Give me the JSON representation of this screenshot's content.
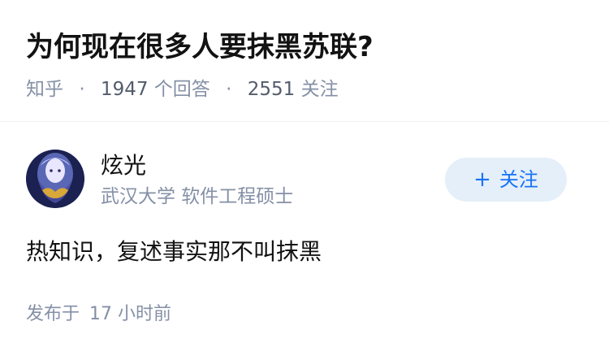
{
  "question": {
    "title": "为何现在很多人要抹黑苏联?",
    "source": "知乎",
    "answer_count": "1947",
    "answer_label": "个回答",
    "follower_count": "2551",
    "follower_label": "关注"
  },
  "answer": {
    "author": {
      "name": "炫光",
      "headline": "武汉大学 软件工程硕士",
      "avatar_icon": "anime-avatar"
    },
    "follow_button": {
      "plus": "+",
      "label": "关注"
    },
    "content": "热知识，复述事实那不叫抹黑",
    "published_label": "发布于",
    "published_time": "17 小时前"
  },
  "colors": {
    "title": "#121212",
    "meta": "#8590a6",
    "follow_bg": "#e5eff9",
    "follow_text": "#1772f6"
  }
}
